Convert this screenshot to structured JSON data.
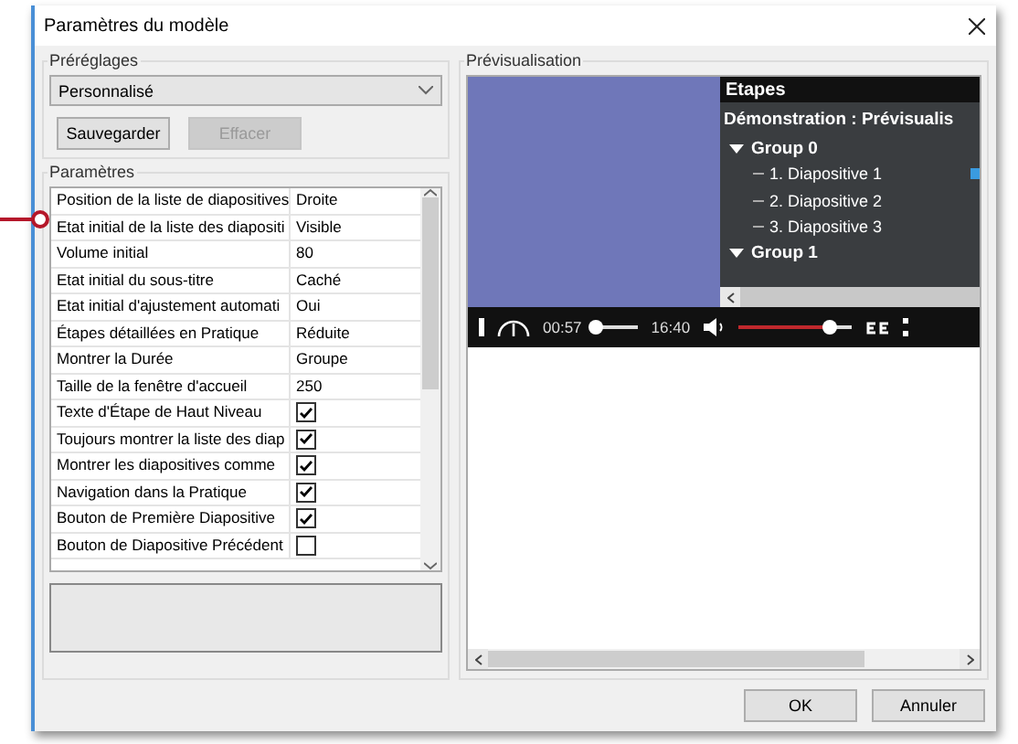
{
  "window": {
    "title": "Paramètres du modèle"
  },
  "presets": {
    "title": "Préréglages",
    "value": "Personnalisé",
    "buttons": [
      {
        "label": "Sauvegarder",
        "disabled": false
      },
      {
        "label": "Effacer",
        "disabled": true
      }
    ]
  },
  "parameters": {
    "title": "Paramètres",
    "rows": [
      {
        "name": "Position de la liste de diapositives",
        "kind": "text",
        "value": "Droite"
      },
      {
        "name": "Etat initial de la liste des diapositi",
        "kind": "text",
        "value": "Visible"
      },
      {
        "name": "Volume initial",
        "kind": "text",
        "value": "80"
      },
      {
        "name": "Etat initial du sous-titre",
        "kind": "text",
        "value": "Caché"
      },
      {
        "name": "Etat initial d'ajustement automati",
        "kind": "text",
        "value": "Oui"
      },
      {
        "name": "Étapes détaillées en Pratique",
        "kind": "text",
        "value": "Réduite"
      },
      {
        "name": "Montrer la Durée",
        "kind": "text",
        "value": "Groupe"
      },
      {
        "name": "Taille de la fenêtre d'accueil",
        "kind": "text",
        "value": "250"
      },
      {
        "name": "Texte d'Étape de Haut Niveau",
        "kind": "checkbox",
        "checked": true
      },
      {
        "name": "Toujours montrer la liste des diap",
        "kind": "checkbox",
        "checked": true
      },
      {
        "name": "Montrer les diapositives comme",
        "kind": "checkbox",
        "checked": true
      },
      {
        "name": "Navigation dans la Pratique",
        "kind": "checkbox",
        "checked": true
      },
      {
        "name": "Bouton de Première Diapositive",
        "kind": "checkbox",
        "checked": true
      },
      {
        "name": "Bouton de Diapositive Précédent",
        "kind": "checkbox",
        "checked": false
      }
    ]
  },
  "preview": {
    "title": "Prévisualisation",
    "panel": {
      "title": "Etapes",
      "course_title": "Démonstration : Prévisualis",
      "groups": [
        {
          "label": "Group 0",
          "expanded": true,
          "items": [
            {
              "label": "1. Diapositive 1",
              "current": true
            },
            {
              "label": "2. Diapositive 2",
              "current": false
            },
            {
              "label": "3. Diapositive 3",
              "current": false
            }
          ]
        },
        {
          "label": "Group 1",
          "expanded": true
        }
      ]
    },
    "player": {
      "current_time": "00:57",
      "total_time": "16:40",
      "seek": {
        "level": 0.05
      },
      "volume": {
        "level": 0.82
      }
    }
  },
  "buttons": [
    "OK",
    "Annuler"
  ]
}
